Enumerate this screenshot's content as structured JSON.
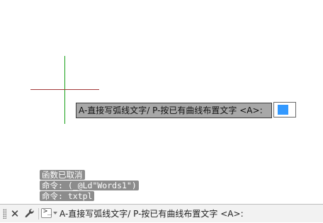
{
  "canvas": {
    "prompt_text": "A-直接写弧线文字/ P-按已有曲线布置文字 <A>:",
    "input_value": ""
  },
  "history": [
    "函数已取消",
    "命令: (_@Ld\"Words1\")",
    "命令: txtpl"
  ],
  "command_line": {
    "text": "A-直接写弧线文字/ P-按已有曲线布置文字 <A>:",
    "close_icon": "✕",
    "customize_icon": "wrench-icon",
    "command_icon": "terminal-icon"
  },
  "colors": {
    "canvas_bg": "#ffffff",
    "crosshair_vertical": "#1aa11a",
    "crosshair_horizontal": "#a33a3a",
    "prompt_bg": "#a8a8a8",
    "input_cursor": "#3399ff",
    "history_bg": "#8c8c8c"
  }
}
